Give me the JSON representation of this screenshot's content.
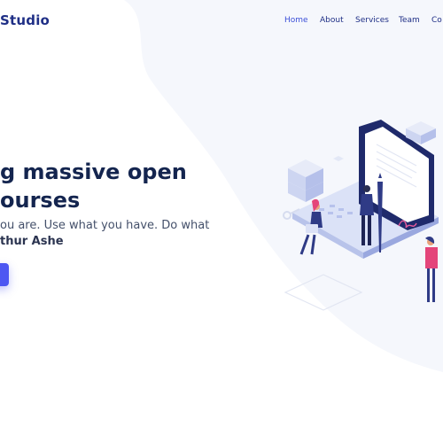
{
  "brand": {
    "name": "Studio"
  },
  "nav": {
    "items": [
      {
        "label": "Home",
        "active": true
      },
      {
        "label": "About"
      },
      {
        "label": "Services"
      },
      {
        "label": "Team"
      },
      {
        "label": "Co"
      }
    ]
  },
  "hero": {
    "title_line1": "g massive open",
    "title_line2": "ourses",
    "sub_line1": "ou are. Use what you have. Do what",
    "sub_author": "thur Ashe",
    "cta_label": ""
  },
  "colors": {
    "brand": "#1f2f86",
    "accent": "#4d57f2",
    "title": "#14254f",
    "background_wave": "#f3f5fb"
  }
}
